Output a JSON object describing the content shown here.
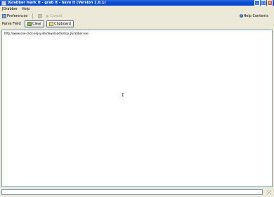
{
  "window": {
    "title": "JGrabber  mark it - grab it - have it (Version 1.0.1)",
    "minimize": "_",
    "maximize": "□",
    "close": "x"
  },
  "menu": {
    "items": [
      "JGrabber",
      "Help"
    ]
  },
  "toolbar": {
    "preferences": "Preferences",
    "disabled_item": "Cancel",
    "help": "Help Contents"
  },
  "parse": {
    "label": "Parse Field",
    "clear": "Clear",
    "clipboard": "Clipboard"
  },
  "editor": {
    "content": "http://www.one-click-enjoy.de/download/setup_JGrabber.exe",
    "cursor": "I"
  },
  "status": {
    "progress_fraction": 0
  },
  "colors": {
    "titlebar": "#0a4fd4",
    "window_bg": "#ece9d8",
    "editor_bg": "#ffffff"
  }
}
